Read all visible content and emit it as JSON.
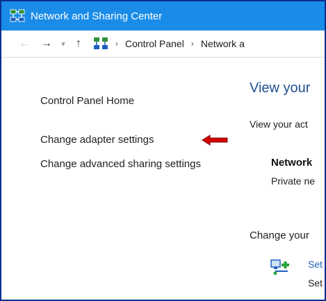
{
  "window": {
    "title": "Network and Sharing Center",
    "title_icon": "network-sharing-icon",
    "titlebar_color": "#1a8ce8"
  },
  "address_bar": {
    "nav_back_icon": "back-arrow-icon",
    "nav_forward_icon": "forward-arrow-icon",
    "nav_recent_icon": "chevron-down-icon",
    "nav_up_icon": "up-arrow-icon",
    "location_icon": "network-sharing-icon",
    "breadcrumbs": [
      "Control Panel",
      "Network a"
    ]
  },
  "left_pane": {
    "links": [
      "Control Panel Home",
      "Change adapter settings",
      "Change advanced sharing settings"
    ],
    "pointer_arrow_color": "#d40000"
  },
  "content": {
    "heading": "View your",
    "subtext": "View your act",
    "network_name": "Network",
    "network_type": "Private ne",
    "change_heading": "Change your",
    "setup_icon": "network-setup-icon",
    "setup_link": "Set",
    "setup_description": "Set"
  }
}
